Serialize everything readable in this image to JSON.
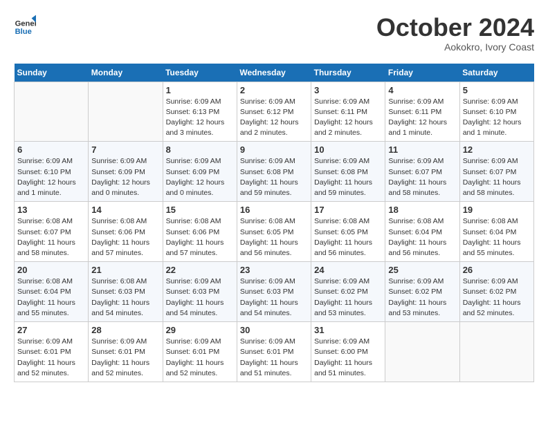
{
  "header": {
    "logo_line1": "General",
    "logo_line2": "Blue",
    "month": "October 2024",
    "location": "Aokokro, Ivory Coast"
  },
  "days_of_week": [
    "Sunday",
    "Monday",
    "Tuesday",
    "Wednesday",
    "Thursday",
    "Friday",
    "Saturday"
  ],
  "weeks": [
    [
      {
        "day": "",
        "info": ""
      },
      {
        "day": "",
        "info": ""
      },
      {
        "day": "1",
        "info": "Sunrise: 6:09 AM\nSunset: 6:13 PM\nDaylight: 12 hours and 3 minutes."
      },
      {
        "day": "2",
        "info": "Sunrise: 6:09 AM\nSunset: 6:12 PM\nDaylight: 12 hours and 2 minutes."
      },
      {
        "day": "3",
        "info": "Sunrise: 6:09 AM\nSunset: 6:11 PM\nDaylight: 12 hours and 2 minutes."
      },
      {
        "day": "4",
        "info": "Sunrise: 6:09 AM\nSunset: 6:11 PM\nDaylight: 12 hours and 1 minute."
      },
      {
        "day": "5",
        "info": "Sunrise: 6:09 AM\nSunset: 6:10 PM\nDaylight: 12 hours and 1 minute."
      }
    ],
    [
      {
        "day": "6",
        "info": "Sunrise: 6:09 AM\nSunset: 6:10 PM\nDaylight: 12 hours and 1 minute."
      },
      {
        "day": "7",
        "info": "Sunrise: 6:09 AM\nSunset: 6:09 PM\nDaylight: 12 hours and 0 minutes."
      },
      {
        "day": "8",
        "info": "Sunrise: 6:09 AM\nSunset: 6:09 PM\nDaylight: 12 hours and 0 minutes."
      },
      {
        "day": "9",
        "info": "Sunrise: 6:09 AM\nSunset: 6:08 PM\nDaylight: 11 hours and 59 minutes."
      },
      {
        "day": "10",
        "info": "Sunrise: 6:09 AM\nSunset: 6:08 PM\nDaylight: 11 hours and 59 minutes."
      },
      {
        "day": "11",
        "info": "Sunrise: 6:09 AM\nSunset: 6:07 PM\nDaylight: 11 hours and 58 minutes."
      },
      {
        "day": "12",
        "info": "Sunrise: 6:09 AM\nSunset: 6:07 PM\nDaylight: 11 hours and 58 minutes."
      }
    ],
    [
      {
        "day": "13",
        "info": "Sunrise: 6:08 AM\nSunset: 6:07 PM\nDaylight: 11 hours and 58 minutes."
      },
      {
        "day": "14",
        "info": "Sunrise: 6:08 AM\nSunset: 6:06 PM\nDaylight: 11 hours and 57 minutes."
      },
      {
        "day": "15",
        "info": "Sunrise: 6:08 AM\nSunset: 6:06 PM\nDaylight: 11 hours and 57 minutes."
      },
      {
        "day": "16",
        "info": "Sunrise: 6:08 AM\nSunset: 6:05 PM\nDaylight: 11 hours and 56 minutes."
      },
      {
        "day": "17",
        "info": "Sunrise: 6:08 AM\nSunset: 6:05 PM\nDaylight: 11 hours and 56 minutes."
      },
      {
        "day": "18",
        "info": "Sunrise: 6:08 AM\nSunset: 6:04 PM\nDaylight: 11 hours and 56 minutes."
      },
      {
        "day": "19",
        "info": "Sunrise: 6:08 AM\nSunset: 6:04 PM\nDaylight: 11 hours and 55 minutes."
      }
    ],
    [
      {
        "day": "20",
        "info": "Sunrise: 6:08 AM\nSunset: 6:04 PM\nDaylight: 11 hours and 55 minutes."
      },
      {
        "day": "21",
        "info": "Sunrise: 6:08 AM\nSunset: 6:03 PM\nDaylight: 11 hours and 54 minutes."
      },
      {
        "day": "22",
        "info": "Sunrise: 6:09 AM\nSunset: 6:03 PM\nDaylight: 11 hours and 54 minutes."
      },
      {
        "day": "23",
        "info": "Sunrise: 6:09 AM\nSunset: 6:03 PM\nDaylight: 11 hours and 54 minutes."
      },
      {
        "day": "24",
        "info": "Sunrise: 6:09 AM\nSunset: 6:02 PM\nDaylight: 11 hours and 53 minutes."
      },
      {
        "day": "25",
        "info": "Sunrise: 6:09 AM\nSunset: 6:02 PM\nDaylight: 11 hours and 53 minutes."
      },
      {
        "day": "26",
        "info": "Sunrise: 6:09 AM\nSunset: 6:02 PM\nDaylight: 11 hours and 52 minutes."
      }
    ],
    [
      {
        "day": "27",
        "info": "Sunrise: 6:09 AM\nSunset: 6:01 PM\nDaylight: 11 hours and 52 minutes."
      },
      {
        "day": "28",
        "info": "Sunrise: 6:09 AM\nSunset: 6:01 PM\nDaylight: 11 hours and 52 minutes."
      },
      {
        "day": "29",
        "info": "Sunrise: 6:09 AM\nSunset: 6:01 PM\nDaylight: 11 hours and 52 minutes."
      },
      {
        "day": "30",
        "info": "Sunrise: 6:09 AM\nSunset: 6:01 PM\nDaylight: 11 hours and 51 minutes."
      },
      {
        "day": "31",
        "info": "Sunrise: 6:09 AM\nSunset: 6:00 PM\nDaylight: 11 hours and 51 minutes."
      },
      {
        "day": "",
        "info": ""
      },
      {
        "day": "",
        "info": ""
      }
    ]
  ]
}
